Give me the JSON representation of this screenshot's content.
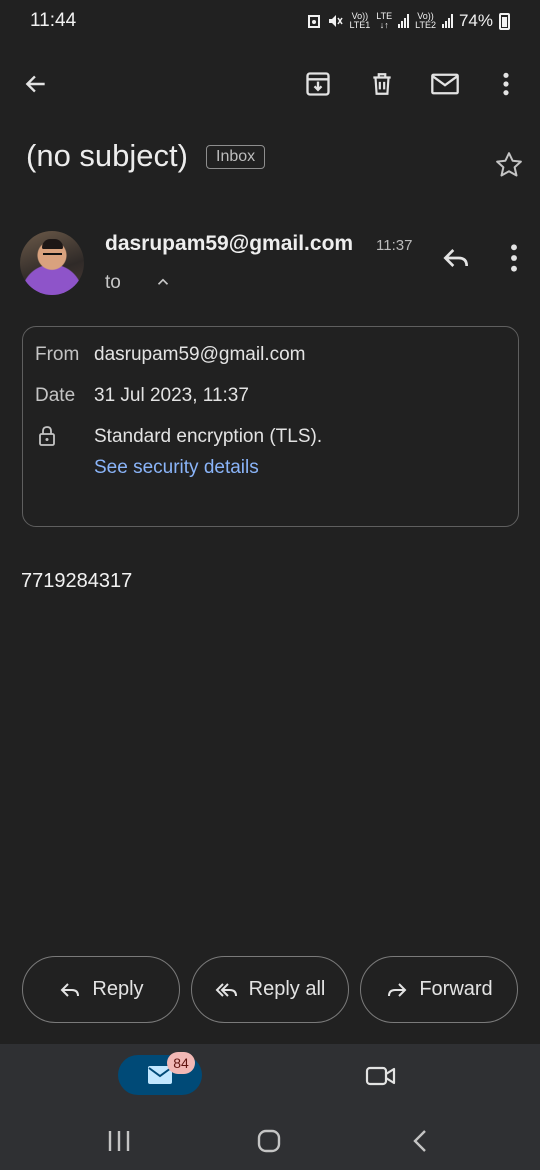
{
  "status_bar": {
    "time": "11:44",
    "sim1_top": "Vo))",
    "sim1_bottom": "LTE1",
    "lte_top": "LTE",
    "lte_bottom": "↓↑",
    "sim2_top": "Vo))",
    "sim2_bottom": "LTE2",
    "battery": "74%"
  },
  "toolbar": {
    "back_icon": "arrow-back-icon",
    "archive_icon": "archive-icon",
    "delete_icon": "trash-icon",
    "mark_unread_icon": "mail-icon",
    "more_icon": "more-vertical-icon"
  },
  "email": {
    "subject": "(no subject)",
    "label_chip": "Inbox",
    "sender": "dasrupam59@gmail.com",
    "time": "11:37",
    "to_label": "to",
    "body": "7719284317"
  },
  "details": {
    "from_label": "From",
    "from_value": "dasrupam59@gmail.com",
    "date_label": "Date",
    "date_value": "31 Jul 2023, 11:37",
    "encryption": "Standard encryption (TLS).",
    "security_link": "See security details"
  },
  "actions": {
    "reply": "Reply",
    "reply_all": "Reply all",
    "forward": "Forward"
  },
  "bottom_nav": {
    "mail_badge": "84"
  },
  "colors": {
    "background": "#212121",
    "link": "#8ab4f8",
    "nav_background": "#2f3033",
    "active_tab": "#004a77",
    "badge": "#f2b8b5"
  }
}
